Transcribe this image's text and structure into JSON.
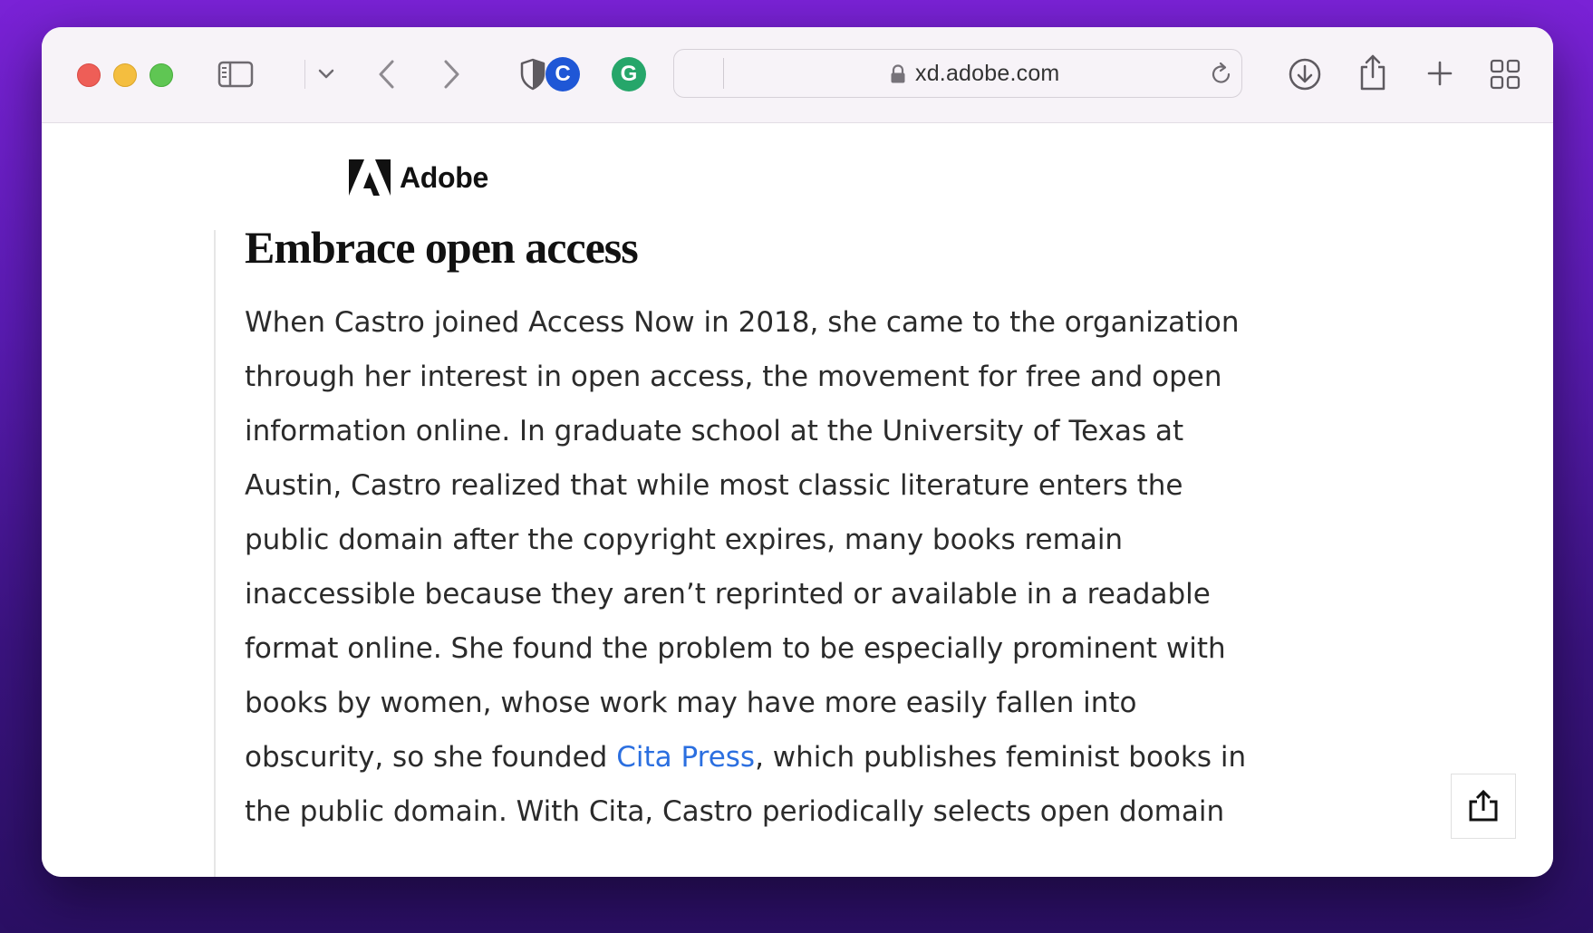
{
  "browser": {
    "url": "xd.adobe.com",
    "extensions": [
      {
        "name": "c-extension",
        "letter": "C",
        "color": "#1f57d6"
      },
      {
        "name": "grammarly-extension",
        "letter": "G",
        "color": "#26a66a"
      }
    ],
    "icons": [
      "sidebar-icon",
      "chevron-down-icon",
      "back-icon",
      "forward-icon",
      "shield-icon",
      "lock-icon",
      "reload-icon",
      "download-icon",
      "share-icon",
      "new-tab-icon",
      "tab-overview-icon"
    ]
  },
  "page": {
    "logo_text": "Adobe",
    "heading": "Embrace open access",
    "body_lines": [
      "When Castro joined Access Now in 2018, she came to the organization",
      "through her interest in open access, the movement for free and open",
      "information online. In graduate school at the University of Texas at",
      "Austin, Castro realized that while most classic literature enters the",
      "public domain after the copyright expires, many books remain",
      "inaccessible because they aren’t reprinted or available in a readable",
      "format online. She found the problem to be especially prominent with",
      "books by women, whose work may have more easily fallen into"
    ],
    "link_line": {
      "before": "obscurity, so she founded ",
      "link": "Cita Press",
      "after": ", which publishes feminist books in"
    },
    "last_line": "the public domain. With Cita, Castro periodically selects open domain",
    "link_color": "#2b6fe0"
  }
}
